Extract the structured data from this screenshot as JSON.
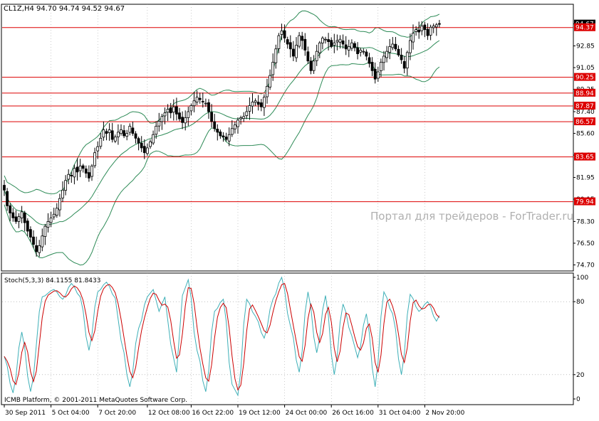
{
  "header": {
    "symbol_line": "CL1Z,H4  94.70 94.74 94.52 94.67"
  },
  "watermark": "Портал для трейдеров - ForTrader.ru",
  "copyright": "ICMB Platform, © 2001-2011 MetaQuotes Software Corp.",
  "colors": {
    "background": "#ffffff",
    "frame": "#000000",
    "level_line": "#dd0000",
    "bollinger": "#2e8b57",
    "candle": "#000000",
    "stoch_main": "#3fb0b8",
    "stoch_signal": "#cc0000",
    "grid_dots": "#9a9a9a",
    "watermark": "#b0b0b0"
  },
  "chart_data": [
    {
      "type": "candlestick",
      "symbol": "CL1Z",
      "timeframe": "H4",
      "ohlc_current": {
        "open": 94.7,
        "high": 94.74,
        "low": 94.52,
        "close": 94.67
      },
      "ylim": [
        74.2,
        96.3
      ],
      "y_ticks": [
        94.67,
        92.85,
        91.05,
        89.25,
        87.4,
        85.6,
        83.8,
        81.95,
        80.15,
        78.3,
        76.5,
        74.7
      ],
      "y_tick_labels": [
        "94.67",
        "92.85",
        "91.05",
        "89.25",
        "87.40",
        "85.60",
        "83.80",
        "81.95",
        "80.15",
        "78.30",
        "76.50",
        "74.70"
      ],
      "current_price_label": "94.67",
      "horizontal_levels": [
        {
          "value": 94.37,
          "label": "94.37"
        },
        {
          "value": 90.25,
          "label": "90.25"
        },
        {
          "value": 88.94,
          "label": "88.94"
        },
        {
          "value": 87.87,
          "label": "87.87"
        },
        {
          "value": 86.57,
          "label": "86.57"
        },
        {
          "value": 83.65,
          "label": "83.65"
        },
        {
          "value": 79.94,
          "label": "79.94"
        }
      ],
      "x_tick_labels": [
        "30 Sep 2011",
        "5 Oct 04:00",
        "7 Oct 20:00",
        "12 Oct 08:00",
        "16 Oct 22:00",
        "19 Oct 12:00",
        "24 Oct 00:00",
        "26 Oct 16:00",
        "31 Oct 04:00",
        "2 Nov 20:00"
      ],
      "x_tick_bar_index": [
        0,
        16,
        32,
        49,
        64,
        80,
        96,
        112,
        128,
        144
      ],
      "overlays": [
        "Bollinger Bands (upper, middle, lower)"
      ],
      "closes": [
        80.9,
        79.6,
        79.0,
        78.6,
        78.3,
        78.7,
        79.1,
        78.2,
        77.5,
        77.0,
        76.4,
        75.8,
        76.3,
        77.1,
        77.9,
        78.3,
        78.6,
        78.9,
        79.4,
        80.2,
        80.9,
        81.7,
        82.2,
        82.1,
        82.7,
        82.4,
        82.9,
        82.7,
        82.3,
        81.9,
        82.9,
        84.0,
        84.5,
        85.2,
        85.9,
        85.6,
        85.9,
        85.1,
        85.3,
        85.7,
        85.9,
        85.4,
        85.6,
        86.2,
        85.6,
        85.2,
        84.8,
        84.4,
        84.0,
        84.4,
        84.9,
        85.5,
        86.2,
        86.6,
        87.0,
        87.3,
        87.6,
        87.3,
        87.8,
        87.2,
        86.8,
        86.5,
        86.9,
        87.4,
        87.9,
        88.3,
        88.6,
        88.4,
        88.2,
        88.1,
        87.4,
        86.6,
        86.0,
        85.7,
        85.4,
        85.3,
        85.1,
        85.5,
        86.0,
        86.3,
        86.7,
        86.9,
        87.0,
        87.4,
        87.9,
        88.2,
        88.3,
        88.0,
        87.8,
        88.6,
        89.5,
        90.4,
        91.5,
        92.6,
        93.7,
        94.1,
        93.5,
        93.0,
        92.6,
        92.0,
        92.9,
        93.7,
        93.3,
        92.5,
        91.6,
        90.8,
        91.6,
        92.4,
        93.1,
        93.5,
        93.4,
        93.2,
        92.8,
        93.1,
        93.3,
        93.4,
        93.0,
        92.6,
        92.8,
        93.1,
        92.7,
        92.2,
        92.5,
        92.4,
        92.0,
        91.4,
        90.8,
        90.1,
        90.7,
        91.5,
        92.0,
        92.4,
        92.8,
        93.0,
        92.6,
        92.1,
        91.7,
        91.0,
        92.3,
        93.3,
        93.9,
        94.2,
        94.0,
        94.5,
        94.2,
        93.7,
        94.4,
        94.5,
        94.6,
        94.67
      ]
    },
    {
      "type": "line",
      "title": "Stoch(5,3,3) 84.1155 81.8433",
      "indicator": "Stochastic Oscillator",
      "params": [
        5,
        3,
        3
      ],
      "ylim": [
        0,
        100
      ],
      "y_tick_labels": [
        "100",
        "80",
        "20",
        "0"
      ],
      "y_ticks": [
        100,
        80,
        20,
        0
      ],
      "levels": [
        80,
        20
      ],
      "series": [
        {
          "name": "%K",
          "color": "#3fb0b8",
          "last": 84.1155
        },
        {
          "name": "%D",
          "color": "#cc0000",
          "last": 81.8433
        }
      ],
      "k_waypoints": [
        [
          0,
          35
        ],
        [
          3,
          5
        ],
        [
          6,
          55
        ],
        [
          9,
          6
        ],
        [
          13,
          84
        ],
        [
          17,
          90
        ],
        [
          20,
          82
        ],
        [
          23,
          95
        ],
        [
          26,
          84
        ],
        [
          29,
          40
        ],
        [
          32,
          88
        ],
        [
          35,
          96
        ],
        [
          38,
          83
        ],
        [
          40,
          48
        ],
        [
          43,
          10
        ],
        [
          46,
          58
        ],
        [
          49,
          84
        ],
        [
          51,
          90
        ],
        [
          53,
          72
        ],
        [
          55,
          84
        ],
        [
          57,
          45
        ],
        [
          59,
          22
        ],
        [
          61,
          85
        ],
        [
          63,
          98
        ],
        [
          66,
          40
        ],
        [
          69,
          6
        ],
        [
          72,
          72
        ],
        [
          75,
          82
        ],
        [
          78,
          12
        ],
        [
          80,
          3
        ],
        [
          83,
          82
        ],
        [
          86,
          68
        ],
        [
          89,
          50
        ],
        [
          92,
          82
        ],
        [
          95,
          100
        ],
        [
          98,
          60
        ],
        [
          101,
          22
        ],
        [
          104,
          88
        ],
        [
          107,
          38
        ],
        [
          110,
          85
        ],
        [
          113,
          20
        ],
        [
          116,
          78
        ],
        [
          119,
          52
        ],
        [
          121,
          34
        ],
        [
          124,
          70
        ],
        [
          127,
          10
        ],
        [
          130,
          88
        ],
        [
          133,
          70
        ],
        [
          136,
          20
        ],
        [
          139,
          86
        ],
        [
          142,
          72
        ],
        [
          145,
          80
        ],
        [
          148,
          64
        ],
        [
          151,
          82
        ],
        [
          152,
          84
        ]
      ]
    }
  ]
}
